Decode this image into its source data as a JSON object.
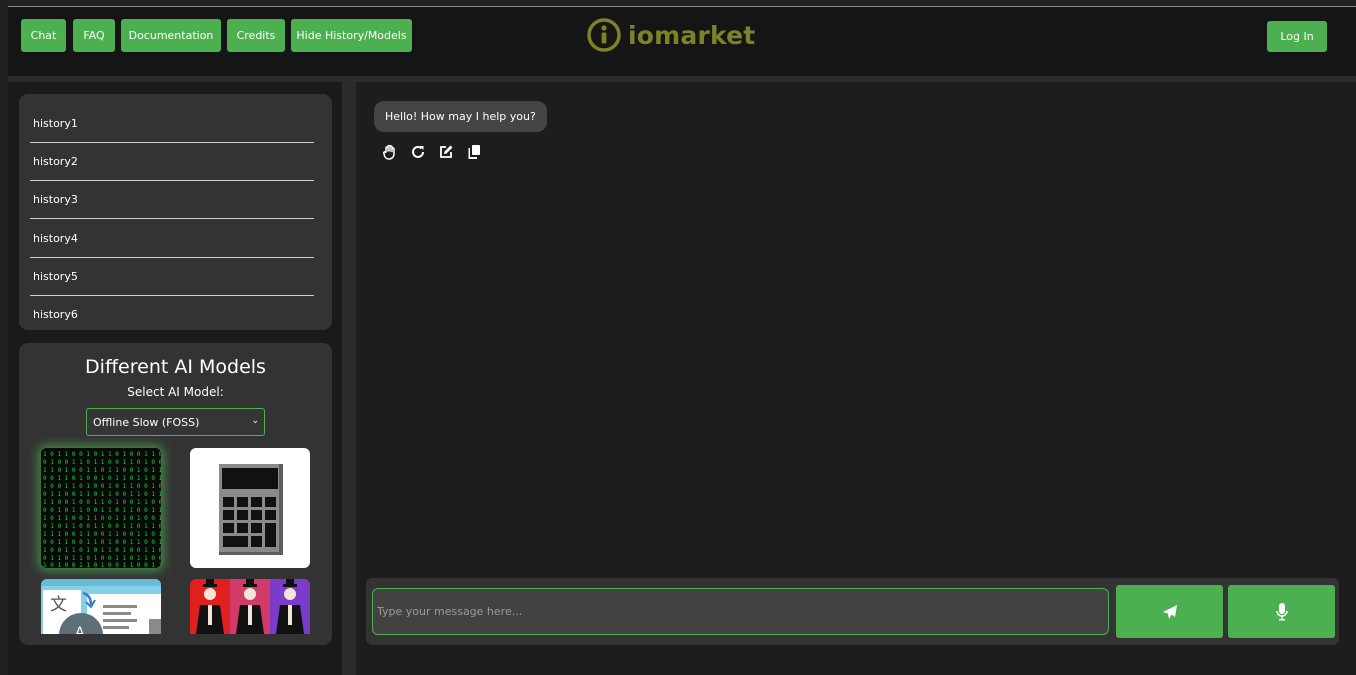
{
  "header": {
    "nav": [
      {
        "label": "Chat"
      },
      {
        "label": "FAQ"
      },
      {
        "label": "Documentation"
      },
      {
        "label": "Credits"
      },
      {
        "label": "Hide History/Models"
      }
    ],
    "logo_text": "iomarket",
    "login_label": "Log In"
  },
  "history": {
    "items": [
      "history1",
      "history2",
      "history3",
      "history4",
      "history5",
      "history6"
    ]
  },
  "models": {
    "title": "Different AI Models",
    "subtitle": "Select AI Model:",
    "selected": "Offline Slow (FOSS)",
    "cards": [
      {
        "icon": "matrix-code-icon"
      },
      {
        "icon": "calculator-icon"
      },
      {
        "icon": "translate-icon"
      },
      {
        "icon": "pop-art-figures-icon"
      }
    ]
  },
  "chat": {
    "greeting": "Hello! How may I help you?",
    "actions": [
      "hand-icon",
      "refresh-icon",
      "edit-icon",
      "copy-icon"
    ],
    "input_placeholder": "Type your message here..."
  },
  "colors": {
    "accent": "#4caf50",
    "logo": "#7d8226",
    "panel": "#333333",
    "background": "#1d1d1d"
  }
}
